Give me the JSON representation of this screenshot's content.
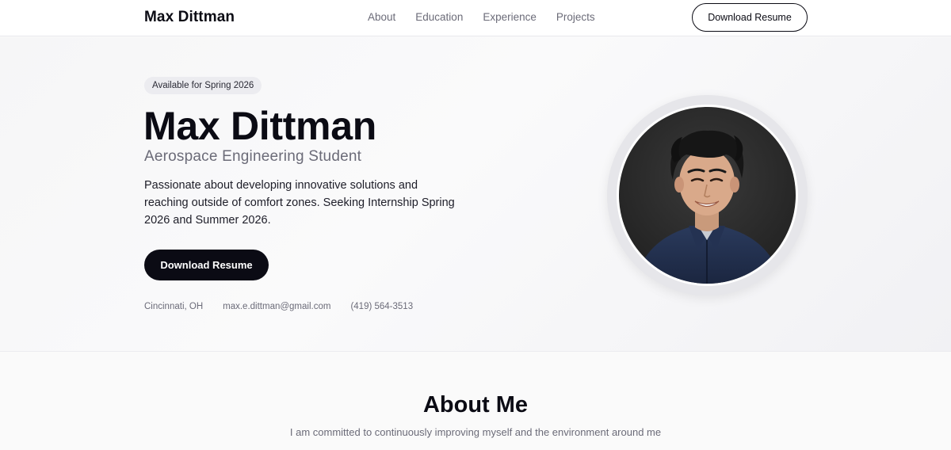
{
  "header": {
    "brand": "Max Dittman",
    "nav": [
      {
        "label": "About"
      },
      {
        "label": "Education"
      },
      {
        "label": "Experience"
      },
      {
        "label": "Projects"
      }
    ],
    "resume_button": "Download Resume"
  },
  "hero": {
    "badge": "Available for Spring 2026",
    "name": "Max Dittman",
    "role": "Aerospace Engineering Student",
    "description": "Passionate about developing innovative solutions and reaching outside of comfort zones. Seeking Internship Spring 2026 and Summer 2026.",
    "resume_button": "Download Resume",
    "contact": {
      "location": "Cincinnati, OH",
      "email": "max.e.dittman@gmail.com",
      "phone": "(419) 564-3513"
    }
  },
  "about": {
    "title": "About Me",
    "subtitle": "I am committed to continuously improving myself and the environment around me"
  }
}
